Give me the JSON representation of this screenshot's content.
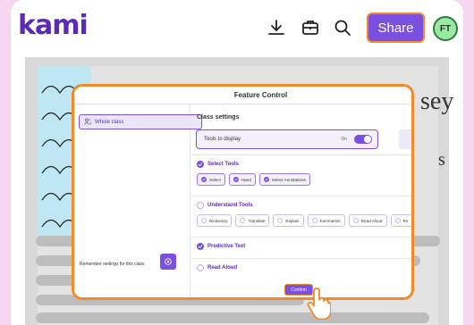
{
  "app": {
    "logo": "kami",
    "share_label": "Share",
    "avatar_initials": "FT"
  },
  "background_doc": {
    "title_fragment": "sey",
    "s_fragment": "s"
  },
  "modal": {
    "title": "Feature Control",
    "sidebar": {
      "selected_item": "Whole class",
      "remember_label": "Remember settings for this class"
    },
    "main": {
      "class_settings": "Class settings",
      "tools_to_display": "Tools to display",
      "toggle_state": "On",
      "sections": [
        {
          "label": "Select Tools",
          "checked": true,
          "chips": [
            {
              "label": "Select",
              "selected": true
            },
            {
              "label": "Hand",
              "selected": true
            },
            {
              "label": "Select Annotations",
              "selected": true
            }
          ]
        },
        {
          "label": "Understand Tools",
          "checked": false,
          "chips": [
            {
              "label": "Dictionary",
              "selected": false
            },
            {
              "label": "Translate",
              "selected": false
            },
            {
              "label": "Explain",
              "selected": false
            },
            {
              "label": "Summarize",
              "selected": false
            },
            {
              "label": "Read Aloud",
              "selected": false
            },
            {
              "label": "Re",
              "selected": false
            }
          ]
        },
        {
          "label": "Predictive Text",
          "checked": true,
          "chips": []
        },
        {
          "label": "Read Aloud",
          "checked": false,
          "chips": []
        }
      ]
    },
    "confirm_label": "Confirm"
  },
  "colors": {
    "brand_purple": "#7b4fe0",
    "highlight_orange": "#f18a2a",
    "page_pink": "#f7d7ef"
  }
}
